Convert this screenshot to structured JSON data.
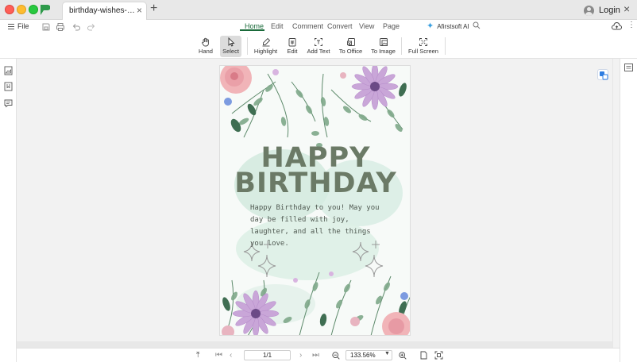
{
  "window": {
    "tab_title": "birthday-wishes-for-w...",
    "new_tab_symbol": "+",
    "close_symbol": "×",
    "login_label": "Login"
  },
  "menu": {
    "file_label": "File",
    "tabs": [
      {
        "label": "Home",
        "active": true
      },
      {
        "label": "Edit",
        "active": false
      },
      {
        "label": "Comment",
        "active": false
      },
      {
        "label": "Convert",
        "active": false
      },
      {
        "label": "View",
        "active": false
      },
      {
        "label": "Page",
        "active": false
      }
    ],
    "ai_label": "Afirstsoft AI"
  },
  "toolbar": {
    "tools": [
      {
        "label": "Hand",
        "icon": "hand-icon",
        "active": false
      },
      {
        "label": "Select",
        "icon": "cursor-icon",
        "active": true
      },
      {
        "label": "Highlight",
        "icon": "highlight-icon",
        "active": false
      },
      {
        "label": "Edit",
        "icon": "edit-icon",
        "active": false
      },
      {
        "label": "Add Text",
        "icon": "add-text-icon",
        "active": false
      },
      {
        "label": "To Office",
        "icon": "to-office-icon",
        "active": false
      },
      {
        "label": "To Image",
        "icon": "to-image-icon",
        "active": false
      },
      {
        "label": "Full Screen",
        "icon": "fullscreen-icon",
        "active": false
      }
    ]
  },
  "document": {
    "headline_1": "HAPPY",
    "headline_2": "BIRTHDAY",
    "message": "Happy Birthday to you! May you day be filled with joy, laughter, and all the things you love."
  },
  "bottom": {
    "page_indicator": "1/1",
    "zoom_level": "133.56%"
  },
  "colors": {
    "accent": "#1a6a3a",
    "headline": "#6b7a66",
    "canvas": "#f2f2f2"
  }
}
